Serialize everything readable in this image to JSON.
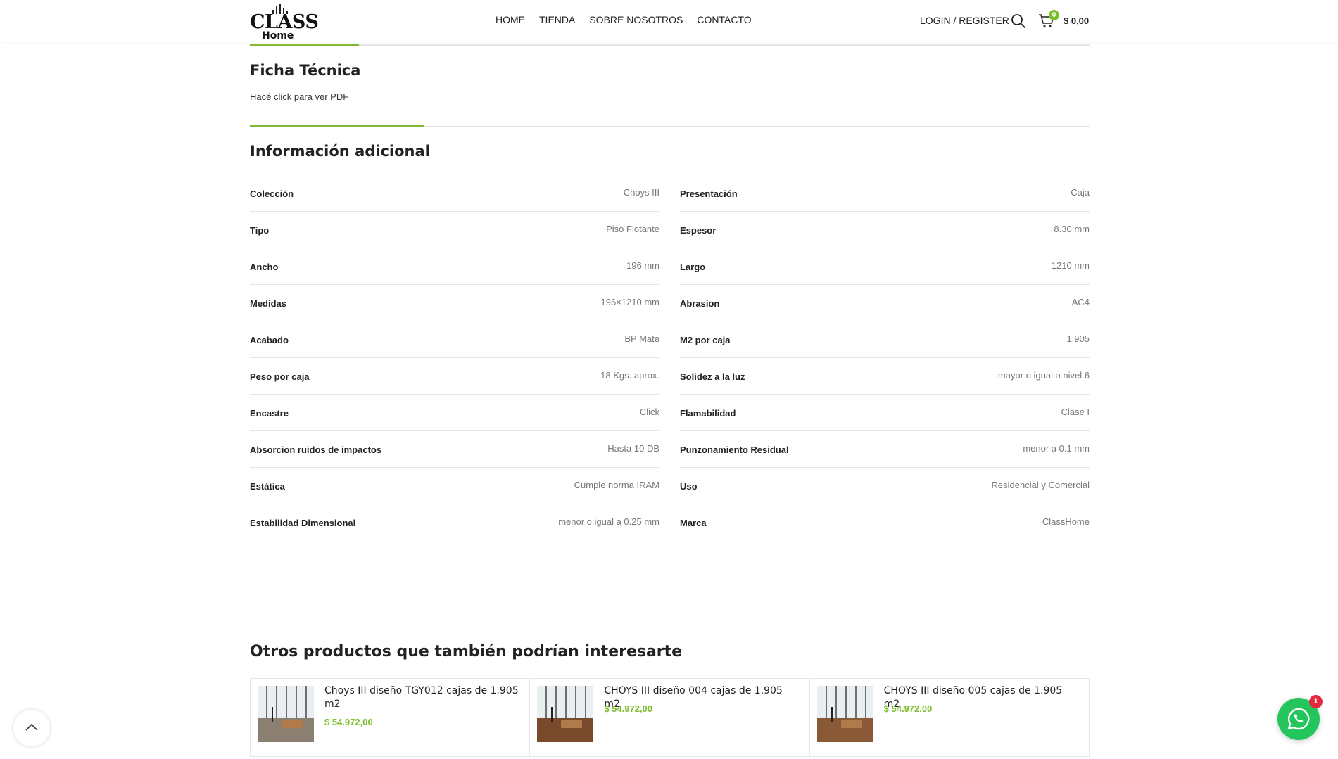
{
  "header": {
    "logo_word": "CLASS",
    "logo_sub": "Home",
    "nav": [
      "HOME",
      "TIENDA",
      "SOBRE NOSOTROS",
      "CONTACTO"
    ],
    "login": "LOGIN / REGISTER",
    "cart_count": "0",
    "cart_total": "$ 0,00"
  },
  "ficha": {
    "title": "Ficha Técnica",
    "link_text": "Hacé click para ver PDF"
  },
  "info": {
    "title": "Información adicional",
    "left": [
      {
        "label": "Colección",
        "value": "Choys III"
      },
      {
        "label": "Tipo",
        "value": "Piso Flotante"
      },
      {
        "label": "Ancho",
        "value": "196 mm"
      },
      {
        "label": "Medidas",
        "value": "196×1210 mm"
      },
      {
        "label": "Acabado",
        "value": "BP Mate"
      },
      {
        "label": "Peso por caja",
        "value": "18 Kgs. aprox."
      },
      {
        "label": "Encastre",
        "value": "Click"
      },
      {
        "label": "Absorcion ruidos de impactos",
        "value": "Hasta 10 DB"
      },
      {
        "label": "Estática",
        "value": "Cumple norma IRAM"
      },
      {
        "label": "Estabilidad Dimensional",
        "value": "menor o igual a 0.25 mm"
      }
    ],
    "right": [
      {
        "label": "Presentación",
        "value": "Caja"
      },
      {
        "label": "Espesor",
        "value": "8.30 mm"
      },
      {
        "label": "Largo",
        "value": "1210 mm"
      },
      {
        "label": "Abrasion",
        "value": "AC4"
      },
      {
        "label": "M2 por caja",
        "value": "1.905"
      },
      {
        "label": "Solidez a la luz",
        "value": "mayor o igual a nivel 6"
      },
      {
        "label": "Flamabilidad",
        "value": "Clase I"
      },
      {
        "label": "Punzonamiento Residual",
        "value": "menor a 0.1 mm"
      },
      {
        "label": "Uso",
        "value": "Residencial y Comercial"
      },
      {
        "label": "Marca",
        "value": "ClassHome"
      }
    ]
  },
  "related": {
    "title": "Otros productos que también podrían interesarte",
    "products": [
      {
        "name": "Choys III diseño TGY012 cajas de 1.905 m2",
        "price": "$ 54.972,00",
        "floor": "#8a7f70"
      },
      {
        "name": "CHOYS III diseño 004 cajas de 1.905 m2",
        "price": "$ 54.972,00",
        "floor": "#7a4a2c"
      },
      {
        "name": "CHOYS III diseño 005 cajas de 1.905 m2",
        "price": "$ 54.972,00",
        "floor": "#8a5a36"
      }
    ]
  },
  "whatsapp": {
    "badge": "1"
  },
  "colors": {
    "accent": "#83b735",
    "price": "#7bbf2a",
    "whatsapp": "#25c55e"
  }
}
